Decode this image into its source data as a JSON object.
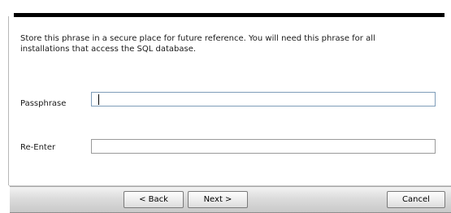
{
  "instructions": "Store this phrase in a secure place for future reference. You will need this phrase for all\ninstallations that access the SQL database.",
  "passphrase": {
    "label": "Passphrase",
    "value": ""
  },
  "reenter": {
    "label": "Re-Enter",
    "value": ""
  },
  "buttons": {
    "back": "< Back",
    "next": "Next >",
    "cancel": "Cancel"
  }
}
